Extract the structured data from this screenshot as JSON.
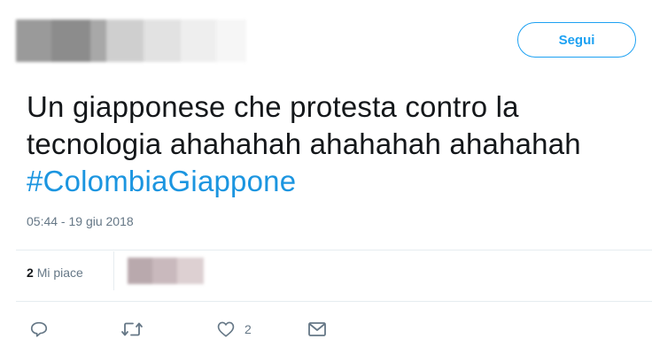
{
  "header": {
    "follow_label": "Segui"
  },
  "tweet": {
    "line1": "Un giapponese che protesta contro la",
    "line2": "tecnologia ahahahah ahahahah ahahahah",
    "hashtag": "#ColombiaGiappone",
    "timestamp": "05:44 - 19 giu 2018"
  },
  "stats": {
    "likes_count": "2",
    "likes_label": "Mi piace"
  },
  "actions": {
    "reply_icon": "reply-icon",
    "retweet_icon": "retweet-icon",
    "like_icon": "heart-icon",
    "like_count": "2",
    "message_icon": "envelope-icon"
  },
  "colors": {
    "accent": "#1da1f2",
    "hashtag": "#1b95e0",
    "muted_text": "#657786"
  }
}
